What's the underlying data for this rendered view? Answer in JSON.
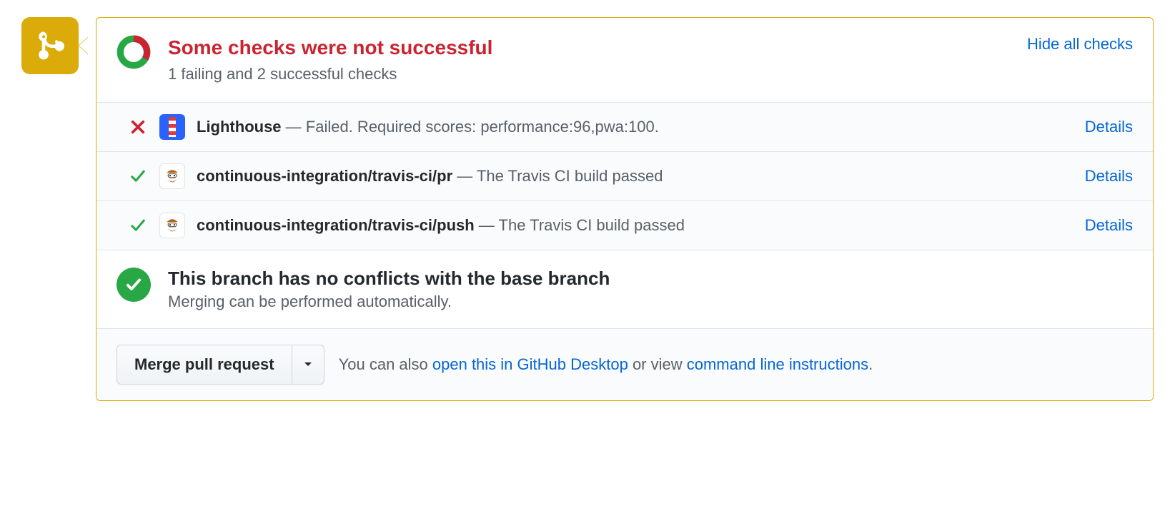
{
  "header": {
    "title": "Some checks were not successful",
    "subtitle": "1 failing and 2 successful checks",
    "toggle_label": "Hide all checks"
  },
  "checks": [
    {
      "status": "fail",
      "avatar": "lighthouse",
      "name": "Lighthouse",
      "sep": " — ",
      "desc": "Failed. Required scores: performance:96,pwa:100.",
      "details_label": "Details"
    },
    {
      "status": "pass",
      "avatar": "travis",
      "name": "continuous-integration/travis-ci/pr",
      "sep": " — ",
      "desc": "The Travis CI build passed",
      "details_label": "Details"
    },
    {
      "status": "pass",
      "avatar": "travis",
      "name": "continuous-integration/travis-ci/push",
      "sep": " — ",
      "desc": "The Travis CI build passed",
      "details_label": "Details"
    }
  ],
  "merge_status": {
    "title": "This branch has no conflicts with the base branch",
    "subtitle": "Merging can be performed automatically."
  },
  "merge_actions": {
    "button_label": "Merge pull request",
    "hint_prefix": "You can also ",
    "desktop_link": "open this in GitHub Desktop",
    "hint_mid": " or view ",
    "cli_link": "command line instructions",
    "hint_suffix": "."
  },
  "colors": {
    "danger": "#cb2431",
    "success": "#28a745",
    "link": "#0366d6",
    "warning_border": "#dbab09"
  }
}
